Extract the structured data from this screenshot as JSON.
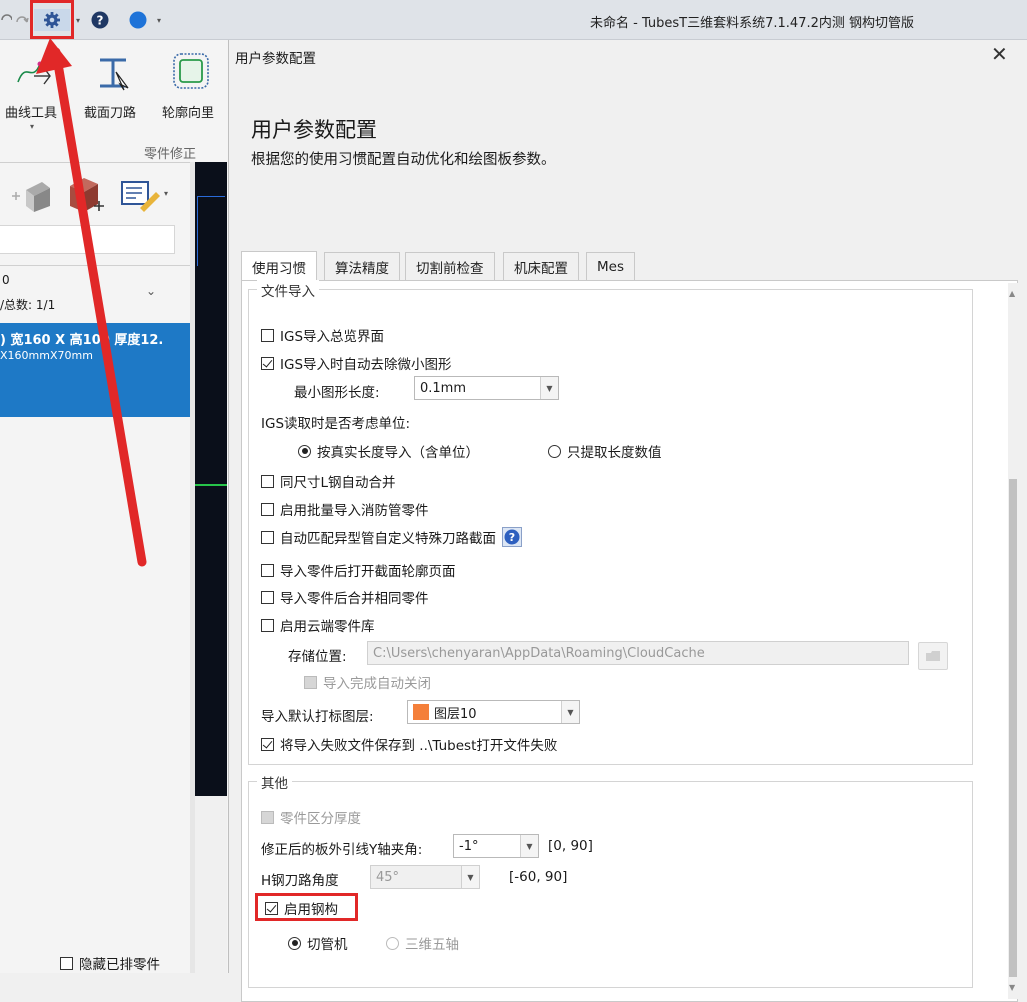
{
  "titlebar": {
    "title": "未命名 - TubesT三维套料系统7.1.47.2内测  钢构切管版",
    "icons": [
      "undo-icon",
      "redo-icon",
      "settings-gear-icon",
      "help-icon",
      "theme-color-icon"
    ]
  },
  "ribbon": {
    "tools": [
      {
        "label": "曲线工具",
        "icon": "curve-tool-icon"
      },
      {
        "label": "截面刀路",
        "icon": "section-toolpath-icon"
      },
      {
        "label": "轮廓向里",
        "icon": "contour-inward-icon"
      }
    ],
    "group_label": "零件修正"
  },
  "left_panel": {
    "count_line": "0",
    "total_line": "/总数: 1/1",
    "selected_title": ") 宽160 X 高100 厚度12.",
    "selected_sub": "X160mmX70mm",
    "hide_label": "隐藏已排零件"
  },
  "dialog": {
    "window_title": "用户参数配置",
    "heading": "用户参数配置",
    "subheading": "根据您的使用习惯配置自动优化和绘图板参数。",
    "tabs": [
      "使用习惯",
      "算法精度",
      "切割前检查",
      "机床配置",
      "Mes"
    ],
    "active_tab": "使用习惯",
    "file_import": {
      "legend": "文件导入",
      "igs_overview": "IGS导入总览界面",
      "igs_remove_small": "IGS导入时自动去除微小图形",
      "min_length_label": "最小图形长度:",
      "min_length_value": "0.1mm",
      "units_label": "IGS读取时是否考虑单位:",
      "radio_real": "按真实长度导入（含单位）",
      "radio_value": "只提取长度数值",
      "merge_l_steel": "同尺寸L钢自动合并",
      "batch_fire_pipe": "启用批量导入消防管零件",
      "auto_match_special": "自动匹配异型管自定义特殊刀路截面",
      "open_section_page": "导入零件后打开截面轮廓页面",
      "merge_same_parts": "导入零件后合并相同零件",
      "cloud_library": "启用云端零件库",
      "storage_label": "存储位置:",
      "storage_path": "C:\\Users\\chenyaran\\AppData\\Roaming\\CloudCache",
      "auto_close": "导入完成自动关闭",
      "default_layer_label": "导入默认打标图层:",
      "default_layer_value": "图层10",
      "layer_color": "#f47f3a",
      "save_failed": "将导入失败文件保存到  ..\\Tubest打开文件失败"
    },
    "other": {
      "legend": "其他",
      "thickness": "零件区分厚度",
      "y_angle_label": "修正后的板外引线Y轴夹角:",
      "y_angle_value": "-1°",
      "y_angle_range": "[0, 90]",
      "h_angle_label": "H钢刀路角度",
      "h_angle_value": "45°",
      "h_angle_range": "[-60, 90]",
      "enable_steel": "启用钢构",
      "radio_cutter": "切管机",
      "radio_5axis": "三维五轴"
    },
    "checks": {
      "igs_overview": false,
      "igs_remove_small": true,
      "merge_l_steel": false,
      "batch_fire_pipe": false,
      "auto_match_special": false,
      "open_section_page": false,
      "merge_same_parts": false,
      "cloud_library": false,
      "auto_close": false,
      "save_failed": true,
      "thickness": false,
      "enable_steel": true
    }
  },
  "annotation_color": "#e12828"
}
